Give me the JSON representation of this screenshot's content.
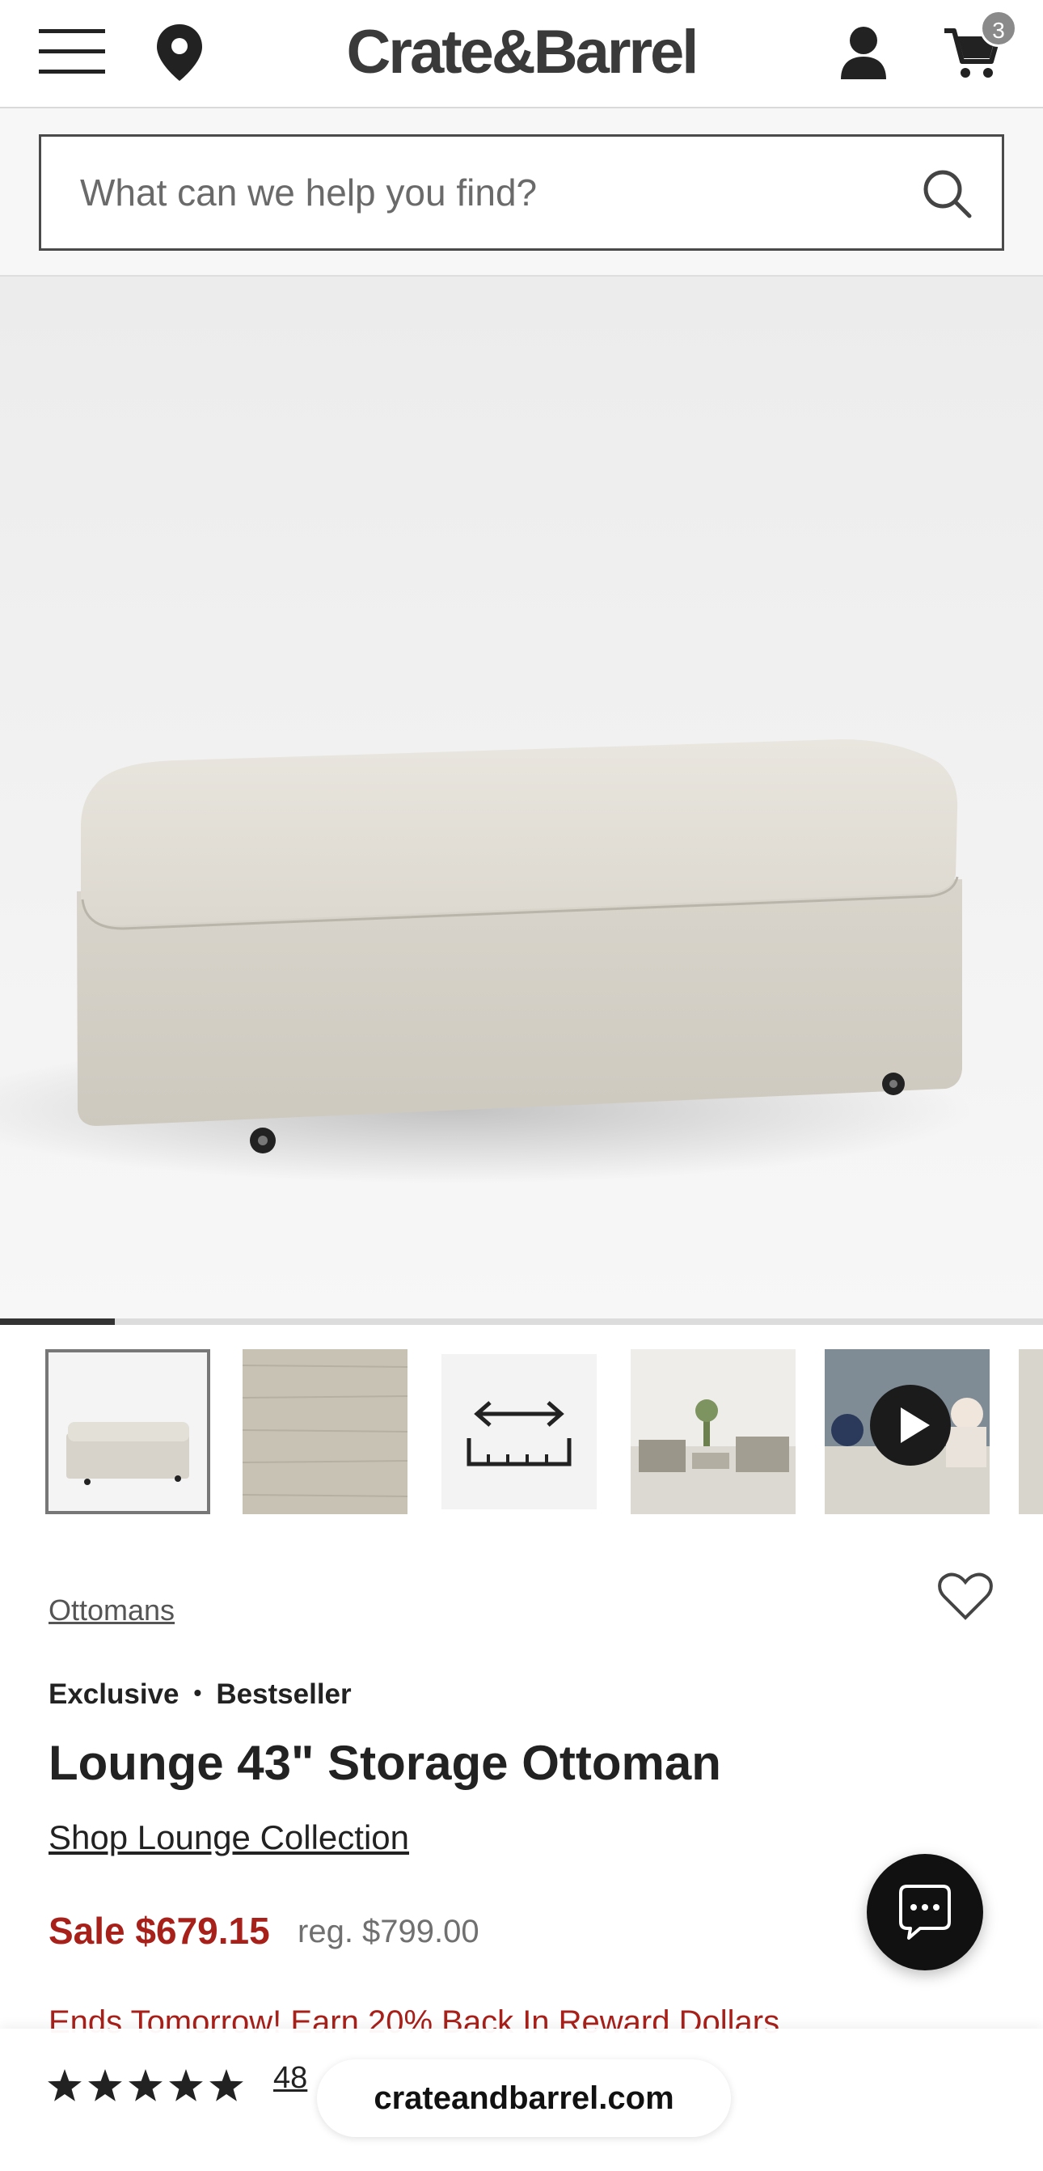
{
  "header": {
    "logo_text": "Crate&Barrel",
    "cart_count": "3",
    "icons": [
      "menu-icon",
      "location-pin-icon",
      "account-icon",
      "cart-icon"
    ]
  },
  "search": {
    "placeholder": "What can we help you find?"
  },
  "gallery": {
    "image_progress": 0.11,
    "thumbnails": [
      "product-photo",
      "fabric-swatch",
      "dimensions",
      "room-scene",
      "video"
    ]
  },
  "product": {
    "category": "Ottomans",
    "badges": [
      "Exclusive",
      "Bestseller"
    ],
    "title": "Lounge 43\" Storage Ottoman",
    "collection_link": "Shop Lounge Collection",
    "sale_price": "Sale $679.15",
    "regular_price": "reg. $799.00",
    "promo": "Ends Tomorrow! Earn 20% Back In Reward Dollars",
    "rating": 5,
    "review_count": "48"
  },
  "browser": {
    "url": "crateandbarrel.com"
  },
  "colors": {
    "sale_red": "#a8201a",
    "text_dark": "#222222",
    "chat_button": "#111111"
  }
}
